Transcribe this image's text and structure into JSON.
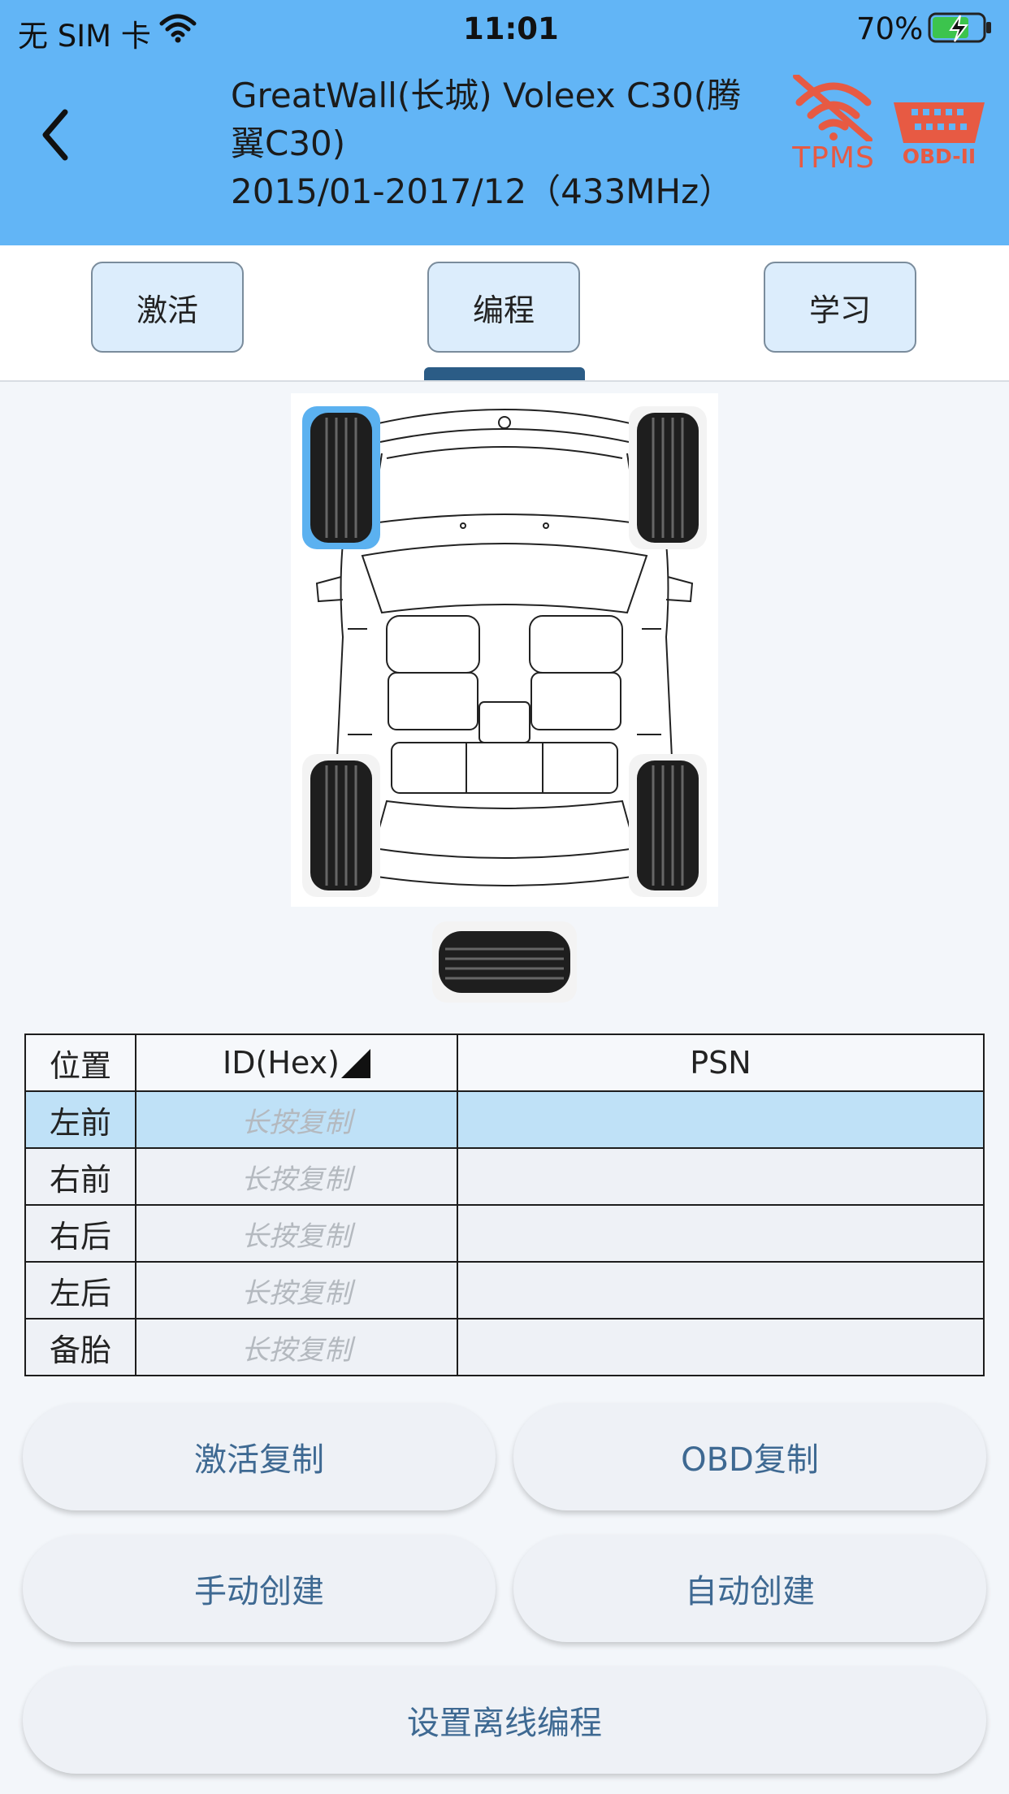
{
  "status_bar": {
    "carrier": "无 SIM 卡",
    "time": "11:01",
    "battery": "70%"
  },
  "header": {
    "vehicle_line1": "GreatWall(长城) Voleex C30(腾",
    "vehicle_line2": "翼C30)",
    "vehicle_line3": "2015/01-2017/12（433MHz）",
    "tpms_label": "TPMS",
    "obd_label": "OBD-II",
    "status_color": "#e75a43"
  },
  "tabs": [
    {
      "label": "激活"
    },
    {
      "label": "编程",
      "selected": true
    },
    {
      "label": "学习"
    }
  ],
  "diagram": {
    "selected_tire": "左前"
  },
  "table": {
    "headers": {
      "position": "位置",
      "id": "ID(Hex)",
      "psn": "PSN"
    },
    "rows": [
      {
        "position": "左前",
        "id": "长按复制",
        "psn": ""
      },
      {
        "position": "右前",
        "id": "长按复制",
        "psn": ""
      },
      {
        "position": "右后",
        "id": "长按复制",
        "psn": ""
      },
      {
        "position": "左后",
        "id": "长按复制",
        "psn": ""
      },
      {
        "position": "备胎",
        "id": "长按复制",
        "psn": ""
      }
    ]
  },
  "actions": {
    "activate_copy": "激活复制",
    "obd_copy": "OBD复制",
    "manual_create": "手动创建",
    "auto_create": "自动创建",
    "offline_program": "设置离线编程"
  },
  "colors": {
    "header_bg": "#62b5f6",
    "tab_indicator": "#2b5c86",
    "selected_row": "#bfe1f7",
    "action_text": "#3e6992"
  }
}
